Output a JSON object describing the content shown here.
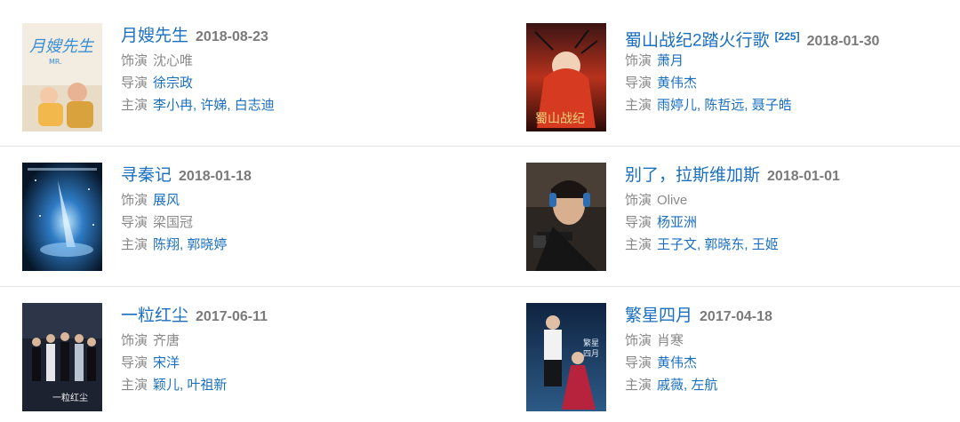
{
  "labels": {
    "role": "饰演",
    "director": "导演",
    "cast": "主演"
  },
  "movies": [
    {
      "title": "月嫂先生",
      "date": "2018-08-23",
      "ref": "",
      "poster_icon": "poster-mr-nanny",
      "role": "沈心唯",
      "role_linked": false,
      "director": "徐宗政",
      "director_linked": true,
      "cast": [
        "李小冉",
        "许娣",
        "白志迪"
      ]
    },
    {
      "title": "蜀山战纪2踏火行歌",
      "date": "2018-01-30",
      "ref": "[225]",
      "poster_icon": "poster-shushan",
      "role": "萧月",
      "role_linked": true,
      "director": "黄伟杰",
      "director_linked": true,
      "cast": [
        "雨婷儿",
        "陈哲远",
        "聂子皓"
      ]
    },
    {
      "title": "寻秦记",
      "date": "2018-01-18",
      "ref": "",
      "poster_icon": "poster-space",
      "role": "展风",
      "role_linked": true,
      "director": "梁国冠",
      "director_linked": false,
      "cast": [
        "陈翔",
        "郭晓婷"
      ]
    },
    {
      "title": "别了，拉斯维加斯",
      "date": "2018-01-01",
      "ref": "",
      "poster_icon": "poster-gun",
      "role": "Olive",
      "role_linked": false,
      "director": "杨亚洲",
      "director_linked": true,
      "cast": [
        "王子文",
        "郭晓东",
        "王姬"
      ]
    },
    {
      "title": "一粒红尘",
      "date": "2017-06-11",
      "ref": "",
      "poster_icon": "poster-group",
      "role": "齐唐",
      "role_linked": false,
      "director": "宋洋",
      "director_linked": true,
      "cast": [
        "颖儿",
        "叶祖新"
      ]
    },
    {
      "title": "繁星四月",
      "date": "2017-04-18",
      "ref": "",
      "poster_icon": "poster-couple",
      "role": "肖寒",
      "role_linked": false,
      "director": "黄伟杰",
      "director_linked": true,
      "cast": [
        "戚薇",
        "左航"
      ]
    }
  ]
}
